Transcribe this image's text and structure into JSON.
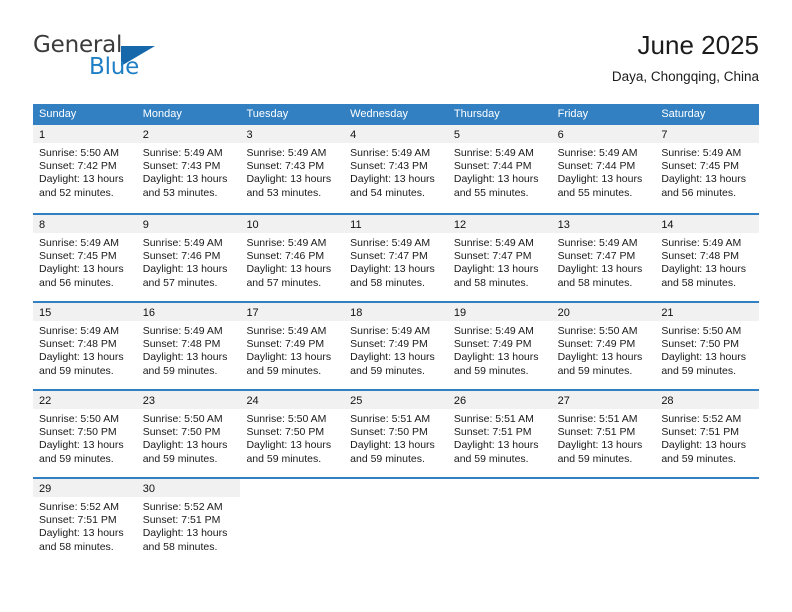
{
  "brand": {
    "name_part1": "General",
    "name_part2": "Blue",
    "triangle_color": "#1668ab",
    "blue_color": "#1f7fc4"
  },
  "header": {
    "title": "June 2025",
    "subtitle": "Daya, Chongqing, China"
  },
  "theme": {
    "header_blue": "#3280c2",
    "day_band_gray": "#f1f1f1",
    "text_color": "#1a1a1a"
  },
  "weekdays": [
    "Sunday",
    "Monday",
    "Tuesday",
    "Wednesday",
    "Thursday",
    "Friday",
    "Saturday"
  ],
  "weeks": [
    {
      "days": [
        {
          "date": "1",
          "sunrise": "Sunrise: 5:50 AM",
          "sunset": "Sunset: 7:42 PM",
          "daylight_1": "Daylight: 13 hours",
          "daylight_2": "and 52 minutes."
        },
        {
          "date": "2",
          "sunrise": "Sunrise: 5:49 AM",
          "sunset": "Sunset: 7:43 PM",
          "daylight_1": "Daylight: 13 hours",
          "daylight_2": "and 53 minutes."
        },
        {
          "date": "3",
          "sunrise": "Sunrise: 5:49 AM",
          "sunset": "Sunset: 7:43 PM",
          "daylight_1": "Daylight: 13 hours",
          "daylight_2": "and 53 minutes."
        },
        {
          "date": "4",
          "sunrise": "Sunrise: 5:49 AM",
          "sunset": "Sunset: 7:43 PM",
          "daylight_1": "Daylight: 13 hours",
          "daylight_2": "and 54 minutes."
        },
        {
          "date": "5",
          "sunrise": "Sunrise: 5:49 AM",
          "sunset": "Sunset: 7:44 PM",
          "daylight_1": "Daylight: 13 hours",
          "daylight_2": "and 55 minutes."
        },
        {
          "date": "6",
          "sunrise": "Sunrise: 5:49 AM",
          "sunset": "Sunset: 7:44 PM",
          "daylight_1": "Daylight: 13 hours",
          "daylight_2": "and 55 minutes."
        },
        {
          "date": "7",
          "sunrise": "Sunrise: 5:49 AM",
          "sunset": "Sunset: 7:45 PM",
          "daylight_1": "Daylight: 13 hours",
          "daylight_2": "and 56 minutes."
        }
      ]
    },
    {
      "days": [
        {
          "date": "8",
          "sunrise": "Sunrise: 5:49 AM",
          "sunset": "Sunset: 7:45 PM",
          "daylight_1": "Daylight: 13 hours",
          "daylight_2": "and 56 minutes."
        },
        {
          "date": "9",
          "sunrise": "Sunrise: 5:49 AM",
          "sunset": "Sunset: 7:46 PM",
          "daylight_1": "Daylight: 13 hours",
          "daylight_2": "and 57 minutes."
        },
        {
          "date": "10",
          "sunrise": "Sunrise: 5:49 AM",
          "sunset": "Sunset: 7:46 PM",
          "daylight_1": "Daylight: 13 hours",
          "daylight_2": "and 57 minutes."
        },
        {
          "date": "11",
          "sunrise": "Sunrise: 5:49 AM",
          "sunset": "Sunset: 7:47 PM",
          "daylight_1": "Daylight: 13 hours",
          "daylight_2": "and 58 minutes."
        },
        {
          "date": "12",
          "sunrise": "Sunrise: 5:49 AM",
          "sunset": "Sunset: 7:47 PM",
          "daylight_1": "Daylight: 13 hours",
          "daylight_2": "and 58 minutes."
        },
        {
          "date": "13",
          "sunrise": "Sunrise: 5:49 AM",
          "sunset": "Sunset: 7:47 PM",
          "daylight_1": "Daylight: 13 hours",
          "daylight_2": "and 58 minutes."
        },
        {
          "date": "14",
          "sunrise": "Sunrise: 5:49 AM",
          "sunset": "Sunset: 7:48 PM",
          "daylight_1": "Daylight: 13 hours",
          "daylight_2": "and 58 minutes."
        }
      ]
    },
    {
      "days": [
        {
          "date": "15",
          "sunrise": "Sunrise: 5:49 AM",
          "sunset": "Sunset: 7:48 PM",
          "daylight_1": "Daylight: 13 hours",
          "daylight_2": "and 59 minutes."
        },
        {
          "date": "16",
          "sunrise": "Sunrise: 5:49 AM",
          "sunset": "Sunset: 7:48 PM",
          "daylight_1": "Daylight: 13 hours",
          "daylight_2": "and 59 minutes."
        },
        {
          "date": "17",
          "sunrise": "Sunrise: 5:49 AM",
          "sunset": "Sunset: 7:49 PM",
          "daylight_1": "Daylight: 13 hours",
          "daylight_2": "and 59 minutes."
        },
        {
          "date": "18",
          "sunrise": "Sunrise: 5:49 AM",
          "sunset": "Sunset: 7:49 PM",
          "daylight_1": "Daylight: 13 hours",
          "daylight_2": "and 59 minutes."
        },
        {
          "date": "19",
          "sunrise": "Sunrise: 5:49 AM",
          "sunset": "Sunset: 7:49 PM",
          "daylight_1": "Daylight: 13 hours",
          "daylight_2": "and 59 minutes."
        },
        {
          "date": "20",
          "sunrise": "Sunrise: 5:50 AM",
          "sunset": "Sunset: 7:49 PM",
          "daylight_1": "Daylight: 13 hours",
          "daylight_2": "and 59 minutes."
        },
        {
          "date": "21",
          "sunrise": "Sunrise: 5:50 AM",
          "sunset": "Sunset: 7:50 PM",
          "daylight_1": "Daylight: 13 hours",
          "daylight_2": "and 59 minutes."
        }
      ]
    },
    {
      "days": [
        {
          "date": "22",
          "sunrise": "Sunrise: 5:50 AM",
          "sunset": "Sunset: 7:50 PM",
          "daylight_1": "Daylight: 13 hours",
          "daylight_2": "and 59 minutes."
        },
        {
          "date": "23",
          "sunrise": "Sunrise: 5:50 AM",
          "sunset": "Sunset: 7:50 PM",
          "daylight_1": "Daylight: 13 hours",
          "daylight_2": "and 59 minutes."
        },
        {
          "date": "24",
          "sunrise": "Sunrise: 5:50 AM",
          "sunset": "Sunset: 7:50 PM",
          "daylight_1": "Daylight: 13 hours",
          "daylight_2": "and 59 minutes."
        },
        {
          "date": "25",
          "sunrise": "Sunrise: 5:51 AM",
          "sunset": "Sunset: 7:50 PM",
          "daylight_1": "Daylight: 13 hours",
          "daylight_2": "and 59 minutes."
        },
        {
          "date": "26",
          "sunrise": "Sunrise: 5:51 AM",
          "sunset": "Sunset: 7:51 PM",
          "daylight_1": "Daylight: 13 hours",
          "daylight_2": "and 59 minutes."
        },
        {
          "date": "27",
          "sunrise": "Sunrise: 5:51 AM",
          "sunset": "Sunset: 7:51 PM",
          "daylight_1": "Daylight: 13 hours",
          "daylight_2": "and 59 minutes."
        },
        {
          "date": "28",
          "sunrise": "Sunrise: 5:52 AM",
          "sunset": "Sunset: 7:51 PM",
          "daylight_1": "Daylight: 13 hours",
          "daylight_2": "and 59 minutes."
        }
      ]
    },
    {
      "days": [
        {
          "date": "29",
          "sunrise": "Sunrise: 5:52 AM",
          "sunset": "Sunset: 7:51 PM",
          "daylight_1": "Daylight: 13 hours",
          "daylight_2": "and 58 minutes."
        },
        {
          "date": "30",
          "sunrise": "Sunrise: 5:52 AM",
          "sunset": "Sunset: 7:51 PM",
          "daylight_1": "Daylight: 13 hours",
          "daylight_2": "and 58 minutes."
        },
        {
          "date": "",
          "sunrise": "",
          "sunset": "",
          "daylight_1": "",
          "daylight_2": ""
        },
        {
          "date": "",
          "sunrise": "",
          "sunset": "",
          "daylight_1": "",
          "daylight_2": ""
        },
        {
          "date": "",
          "sunrise": "",
          "sunset": "",
          "daylight_1": "",
          "daylight_2": ""
        },
        {
          "date": "",
          "sunrise": "",
          "sunset": "",
          "daylight_1": "",
          "daylight_2": ""
        },
        {
          "date": "",
          "sunrise": "",
          "sunset": "",
          "daylight_1": "",
          "daylight_2": ""
        }
      ]
    }
  ]
}
